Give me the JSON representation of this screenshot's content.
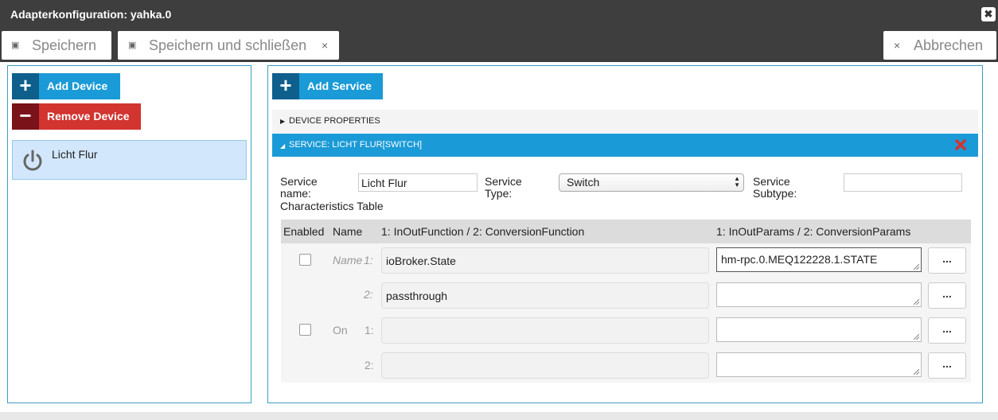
{
  "window": {
    "title": "Adapterkonfiguration: yahka.0",
    "close_glyph": "✖"
  },
  "toolbar": {
    "save_label": "Speichern",
    "save_close_label": "Speichern und schließen",
    "cancel_label": "Abbrechen",
    "save_icon": "floppy-icon",
    "close_glyph": "×"
  },
  "devices": {
    "add_label": "Add Device",
    "remove_label": "Remove Device",
    "add_glyph": "+",
    "remove_glyph": "−",
    "items": [
      {
        "name": "Licht Flur",
        "icon": "power-icon"
      }
    ]
  },
  "services": {
    "add_label": "Add Service",
    "add_glyph": "+",
    "device_properties_label": "DEVICE PROPERTIES",
    "service_header_label": "SERVICE: LICHT FLUR[SWITCH]",
    "form": {
      "name_label": "Service name:",
      "name_label_1": "Service",
      "name_label_2": "name:",
      "name_value": "Licht Flur",
      "type_label_1": "Service",
      "type_label_2": "Type:",
      "type_value": "Switch",
      "subtype_label_1": "Service",
      "subtype_label_2": "Subtype:",
      "subtype_value": "",
      "characteristics_label": "Characteristics Table"
    },
    "table": {
      "headers": {
        "enabled": "Enabled",
        "name": "Name",
        "function": "1: InOutFunction / 2: ConversionFunction",
        "params": "1: InOutParams / 2: ConversionParams"
      },
      "rows": [
        {
          "name": "Name",
          "idx1": "1:",
          "idx2": "2:",
          "fn1": "ioBroker.State",
          "fn2": "passthrough",
          "p1": "hm-rpc.0.MEQ122228.1.STATE",
          "p2": "",
          "enabled": false
        },
        {
          "name": "On",
          "idx1": "1:",
          "idx2": "2:",
          "fn1": "",
          "fn2": "",
          "p1": "",
          "p2": "",
          "enabled": false
        }
      ],
      "more_glyph": "..."
    }
  },
  "colors": {
    "accent": "#1a9ad6",
    "danger": "#d23430",
    "titlebar": "#3e3e3e",
    "selected": "#d2e7fb"
  }
}
